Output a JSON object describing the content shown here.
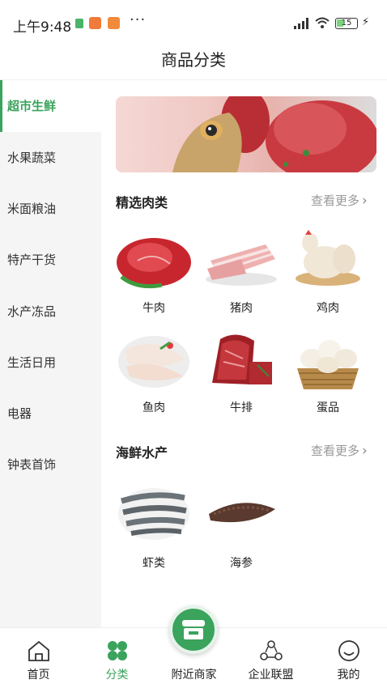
{
  "status_bar": {
    "time": "上午9:48",
    "more": "···",
    "battery": "15"
  },
  "header": {
    "title": "商品分类"
  },
  "sidebar": {
    "items": [
      {
        "label": "超市生鲜",
        "active": true
      },
      {
        "label": "水果蔬菜",
        "active": false
      },
      {
        "label": "米面粮油",
        "active": false
      },
      {
        "label": "特产干货",
        "active": false
      },
      {
        "label": "水产冻品",
        "active": false
      },
      {
        "label": "生活日用",
        "active": false
      },
      {
        "label": "电器",
        "active": false
      },
      {
        "label": "钟表首饰",
        "active": false
      }
    ]
  },
  "sections": [
    {
      "title": "精选肉类",
      "more": "查看更多",
      "products": [
        "牛肉",
        "猪肉",
        "鸡肉",
        "鱼肉",
        "牛排",
        "蛋品"
      ]
    },
    {
      "title": "海鲜水产",
      "more": "查看更多",
      "products": [
        "虾类",
        "海参"
      ]
    }
  ],
  "bottom_nav": {
    "items": [
      {
        "label": "首页",
        "icon": "home-icon"
      },
      {
        "label": "分类",
        "icon": "category-icon",
        "active": true
      },
      {
        "label": "附近商家",
        "icon": "store-icon"
      },
      {
        "label": "企业联盟",
        "icon": "alliance-icon"
      },
      {
        "label": "我的",
        "icon": "smile-icon"
      }
    ]
  },
  "colors": {
    "accent": "#3aa35c"
  }
}
